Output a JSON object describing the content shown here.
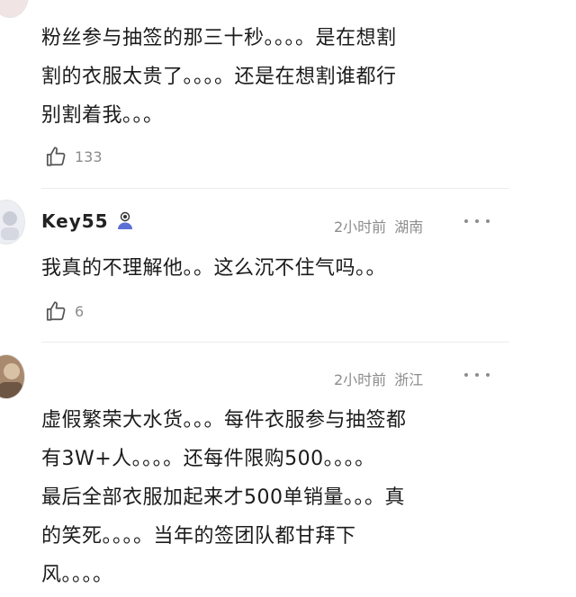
{
  "comments": [
    {
      "username": "",
      "lines": [
        "粉丝参与抽签的那三十秒。。。。是在想割",
        "割的衣服太贵了。。。。还是在想割谁都行",
        "别割着我。。。"
      ],
      "likes": "133"
    },
    {
      "username": "Key55",
      "time": "2小时前",
      "location": "湖南",
      "lines": [
        "我真的不理解他。。这么沉不住气吗。。"
      ],
      "likes": "6"
    },
    {
      "username": "",
      "time": "2小时前",
      "location": "浙江",
      "lines": [
        "虚假繁荣大水货。。。每件衣服参与抽签都",
        "有3W+人。。。。还每件限购500。。。。",
        "最后全部衣服加起来才500单销量。。。真",
        "的笑死。。。。当年的签团队都甘拜下",
        "风。。。。"
      ]
    }
  ],
  "icons": {
    "like": "thumbs-up-icon",
    "more": "more-dots-icon",
    "badge": "user-badge-icon"
  },
  "colors": {
    "text": "#1b1b1b",
    "meta": "#8c8c8c",
    "divider": "#ececec",
    "badge": "#5b6fd6"
  }
}
